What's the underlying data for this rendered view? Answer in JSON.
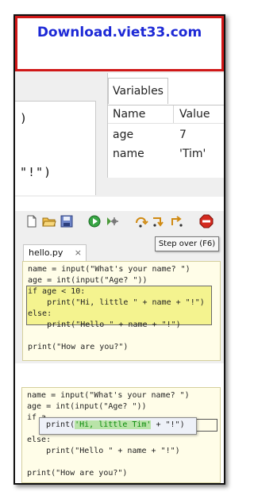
{
  "banner": {
    "text": "Download.viet33.com"
  },
  "panel1": {
    "code_fragment_1": ")",
    "code_fragment_2": "\"!\")",
    "variables": {
      "tab_label": "Variables",
      "col_name": "Name",
      "col_value": "Value",
      "rows": [
        {
          "name": "age",
          "value": "7"
        },
        {
          "name": "name",
          "value": "'Tim'"
        }
      ]
    }
  },
  "panel2": {
    "toolbar": {
      "icons": [
        "new-file-icon",
        "open-folder-icon",
        "save-icon",
        "run-icon",
        "debug-icon",
        "step-over-icon",
        "step-into-icon",
        "step-out-icon",
        "stop-icon"
      ],
      "tooltip": "Step over (F6)"
    },
    "tab": {
      "label": "hello.py",
      "close": "×"
    },
    "code_lines": [
      "name = input(\"What's your name? \")",
      "age = int(input(\"Age? \"))",
      "if age < 10:",
      "    print(\"Hi, little \" + name + \"!\")",
      "else:",
      "    print(\"Hello \" + name + \"!\")",
      "",
      "print(\"How are you?\")"
    ]
  },
  "panel3": {
    "code_lines": [
      "name = input(\"What's your name? \")",
      "age = int(input(\"Age? \"))",
      "if a",
      "",
      "else:",
      "    print(\"Hello \" + name + \"!\")",
      "",
      "print(\"How are you?\")"
    ],
    "popup": {
      "prefix": "print(",
      "evaluated": "'Hi, little Tim'",
      "suffix": " + \"!\")"
    }
  },
  "colors": {
    "banner_text": "#1d29d6",
    "banner_border": "#d01818",
    "highlight_block": "#f4f38f",
    "editor_bg": "#fffde8",
    "string": "#0a8a0a",
    "keyword": "#0000cc"
  }
}
